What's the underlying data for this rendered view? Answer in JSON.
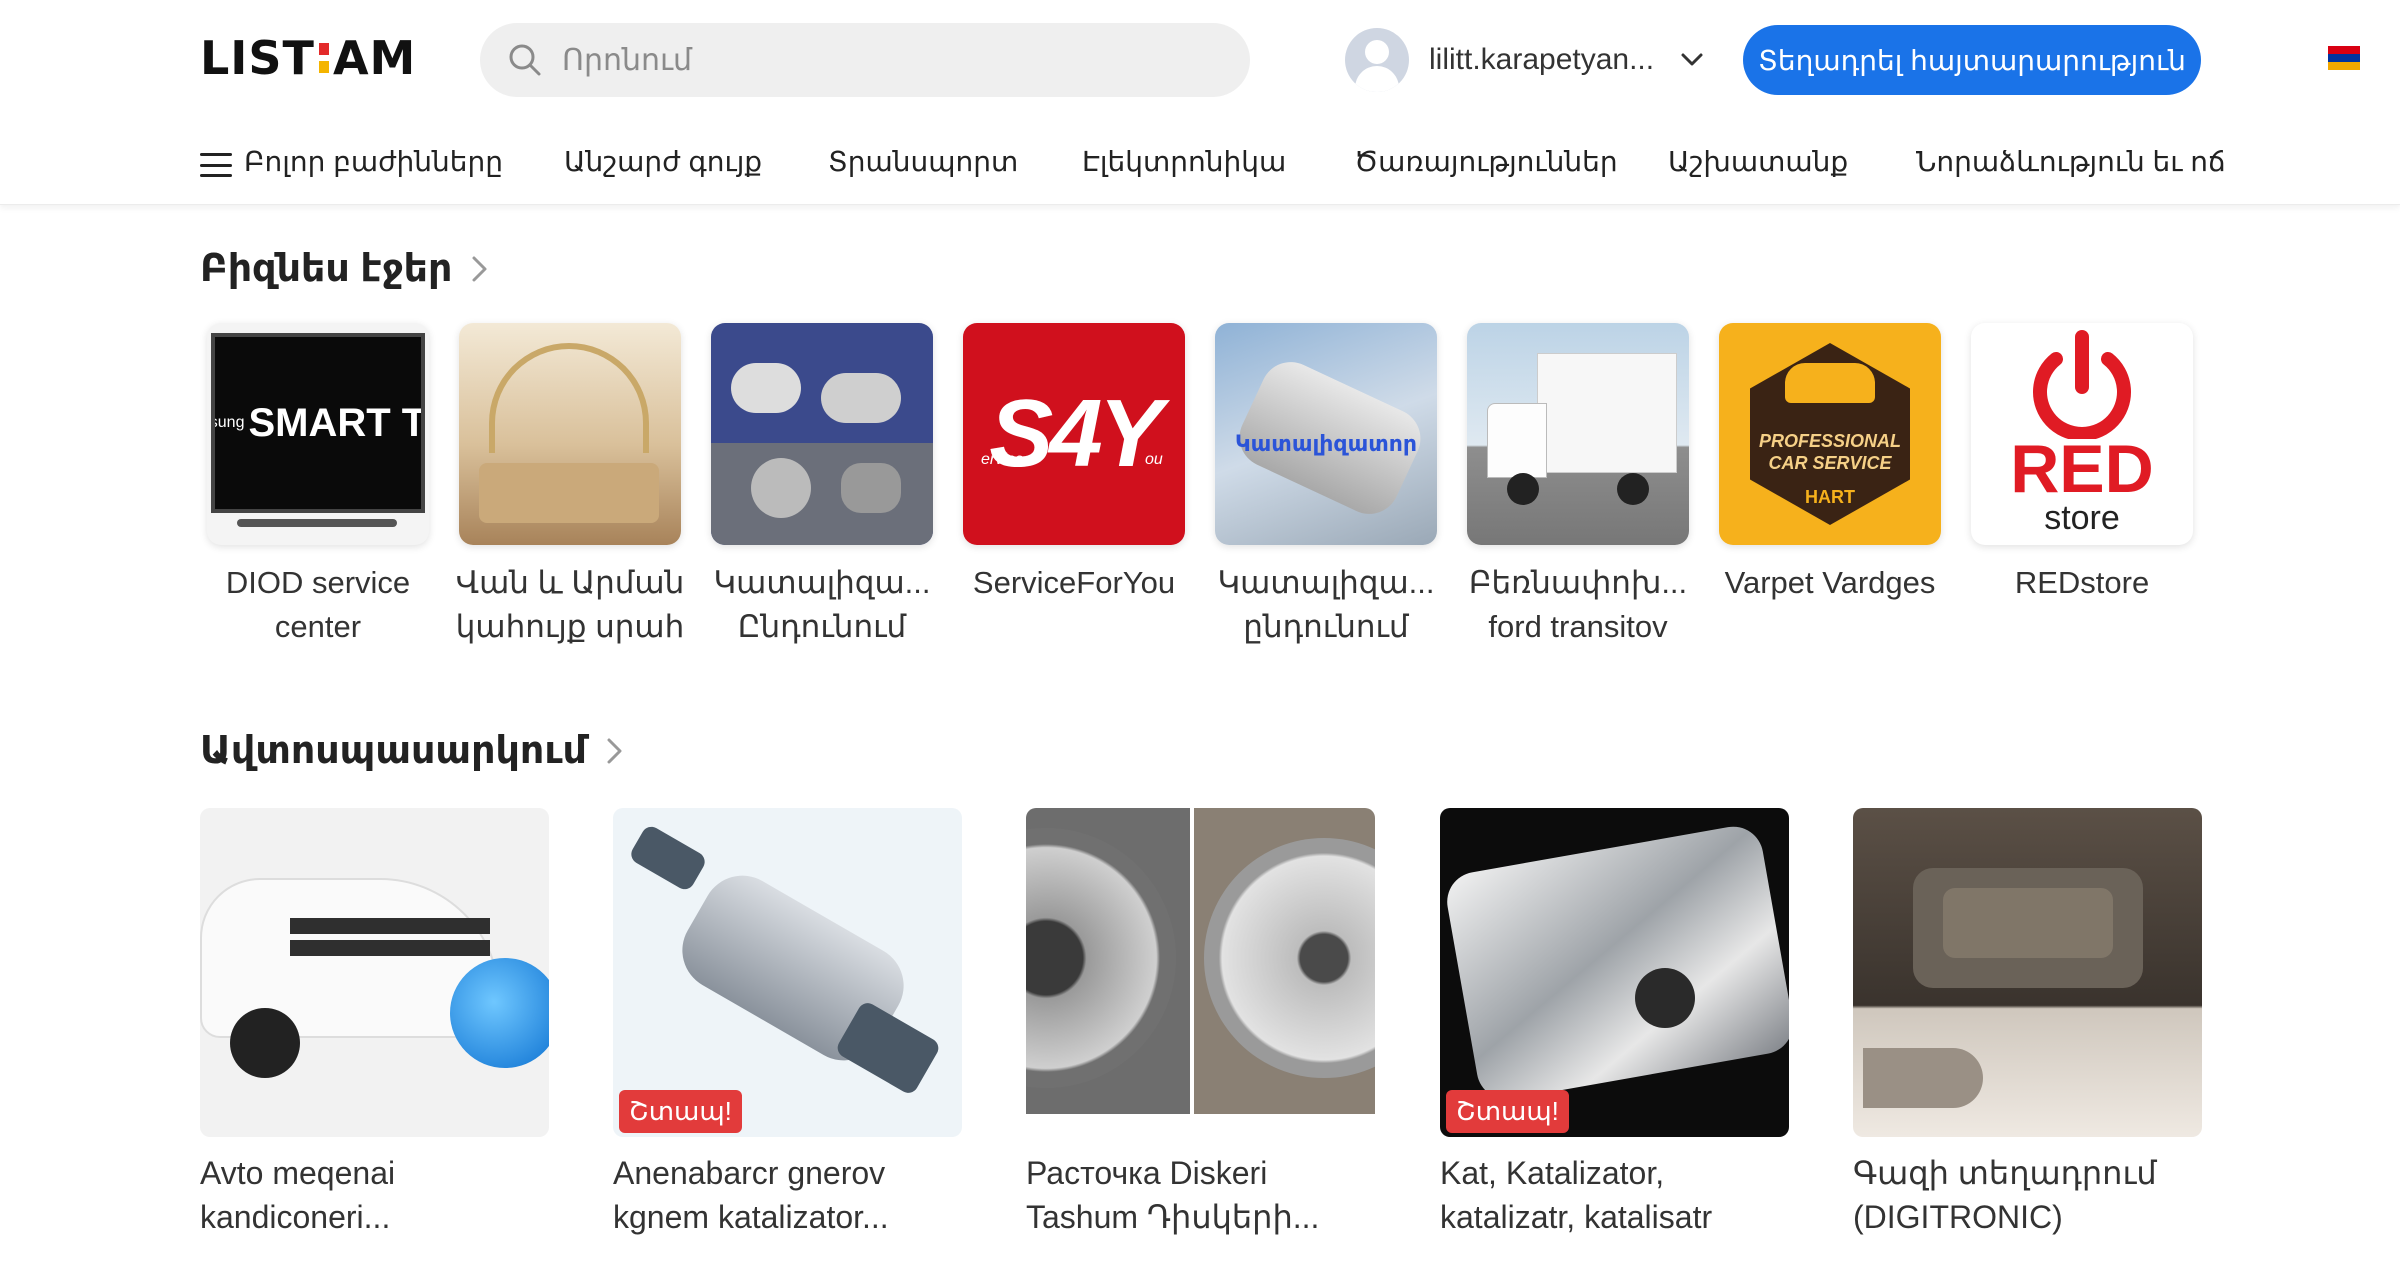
{
  "logo": {
    "text_left": "LIST",
    "text_right": "AM",
    "colors": [
      "#e32a2a",
      "#f4b400"
    ]
  },
  "search": {
    "placeholder": "Որոնում",
    "icon": "search-icon"
  },
  "user": {
    "name": "lilitt.karapetyan...",
    "avatar_icon": "user-avatar-icon",
    "chevron_icon": "chevron-down-icon"
  },
  "post_button": {
    "label": "Տեղադրել հայտարարություն",
    "color": "#1a73e8"
  },
  "language_flag": {
    "icon": "armenian-flag-icon",
    "colors": [
      "#d90012",
      "#0033a0",
      "#f2a800"
    ]
  },
  "nav": {
    "menu_icon": "hamburger-icon",
    "items": [
      {
        "label": "Բոլոր բաժինները"
      },
      {
        "label": "Անշարժ գույք"
      },
      {
        "label": "Տրանսպորտ"
      },
      {
        "label": "Էլեկտրոնիկա"
      },
      {
        "label": "Ծառայություններ"
      },
      {
        "label": "Աշխատանք"
      },
      {
        "label": "Նորաձևություն եւ ոճ"
      }
    ]
  },
  "business_pages": {
    "title": "Բիզնես էջեր",
    "arrow_icon": "chevron-right-icon",
    "items": [
      {
        "name_line1": "DIOD service",
        "name_line2": "center",
        "thumb_text": "SMART T",
        "thumb_small": "sung"
      },
      {
        "name_line1": "Վան և Արման",
        "name_line2": "կահույք սրահ"
      },
      {
        "name_line1": "Կատալիզա...",
        "name_line2": "Ընդունում"
      },
      {
        "name_line1": "ServiceForYou",
        "name_line2": "",
        "thumb_text": "S4Y",
        "thumb_small_a": "ervice",
        "thumb_small_b": "ou"
      },
      {
        "name_line1": "Կատալիզա...",
        "name_line2": "ընդունում",
        "thumb_text": "Կատալիզատոր"
      },
      {
        "name_line1": "Բեռնափոխ...",
        "name_line2": "ford transitov"
      },
      {
        "name_line1": "Varpet Vardges",
        "name_line2": "",
        "thumb_text_a": "PROFESSIONAL",
        "thumb_text_b": "CAR SERVICE",
        "thumb_text_c": "HART"
      },
      {
        "name_line1": "REDstore",
        "name_line2": "",
        "thumb_text_a": "RED",
        "thumb_text_b": "store"
      }
    ]
  },
  "auto_service": {
    "title": "Ավտոսպասարկում",
    "arrow_icon": "chevron-right-icon",
    "items": [
      {
        "title_line1": "Avto meqenai",
        "title_line2": "kandiconeri...",
        "badge": ""
      },
      {
        "title_line1": "Anenabarcr gnerov",
        "title_line2": "kgnem katalizator...",
        "badge": "Շտապ!"
      },
      {
        "title_line1": "Расточка Diskeri",
        "title_line2": "Tashum Դիսկերի...",
        "badge": ""
      },
      {
        "title_line1": "Kat, Katalizator,",
        "title_line2": "katalizatr, katalisatr",
        "badge": "Շտապ!"
      },
      {
        "title_line1": "Գազի տեղադրում",
        "title_line2": "(DIGITRONIC)",
        "badge": ""
      }
    ]
  }
}
